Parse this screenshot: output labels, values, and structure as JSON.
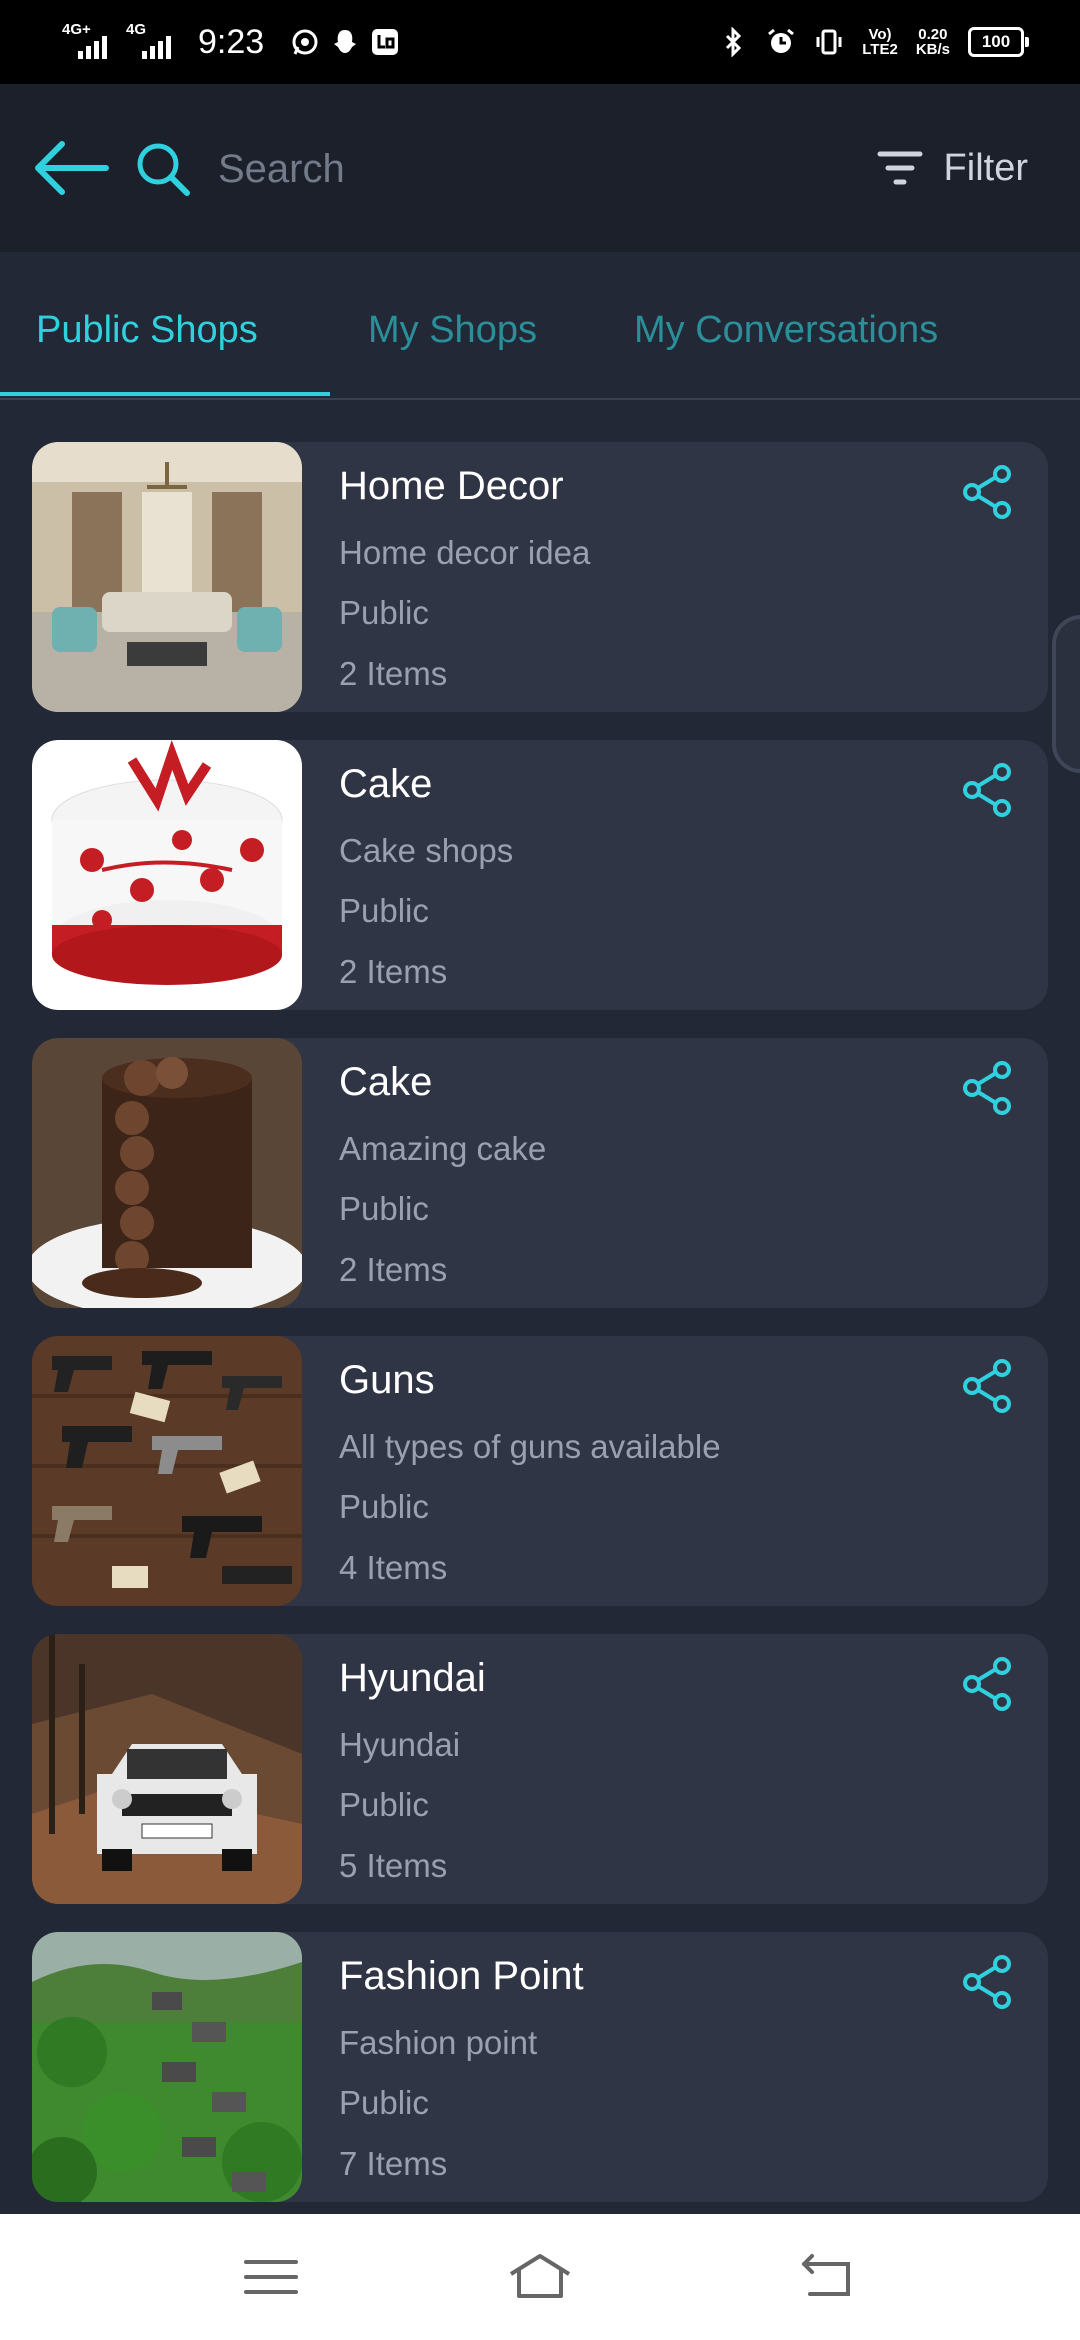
{
  "status_bar": {
    "time": "9:23",
    "sim1_label": "4G+",
    "sim2_label": "4G",
    "volte_label_1": "Vo)",
    "volte_label_2": "LTE2",
    "net_speed_value": "0.20",
    "net_speed_unit": "KB/s",
    "battery": "100",
    "icons": [
      "whatsapp-icon",
      "snapchat-icon",
      "app-icon",
      "bluetooth-icon",
      "alarm-icon",
      "vibrate-icon"
    ]
  },
  "header": {
    "search_placeholder": "Search",
    "filter_label": "Filter"
  },
  "tabs": [
    {
      "label": "Public Shops",
      "active": true
    },
    {
      "label": "My Shops",
      "active": false
    },
    {
      "label": "My Conversations",
      "active": false
    }
  ],
  "shops": [
    {
      "title": "Home Decor",
      "description": "Home decor idea",
      "visibility": "Public",
      "items": "2 Items",
      "image": "living-room"
    },
    {
      "title": "Cake",
      "description": "Cake shops",
      "visibility": "Public",
      "items": "2 Items",
      "image": "birthday-cake"
    },
    {
      "title": "Cake",
      "description": "Amazing cake",
      "visibility": "Public",
      "items": "2 Items",
      "image": "chocolate-cake"
    },
    {
      "title": "Guns",
      "description": "All types of guns available",
      "visibility": "Public",
      "items": "4 Items",
      "image": "guns"
    },
    {
      "title": "Hyundai",
      "description": "Hyundai",
      "visibility": "Public",
      "items": "5 Items",
      "image": "suv"
    },
    {
      "title": "Fashion Point",
      "description": "Fashion point",
      "visibility": "Public",
      "items": "7 Items",
      "image": "hillside"
    }
  ],
  "colors": {
    "accent": "#2ed1dd",
    "tab_inactive": "#2a8f99",
    "background": "#232836",
    "card": "#2f3545",
    "header": "#1b202b"
  }
}
